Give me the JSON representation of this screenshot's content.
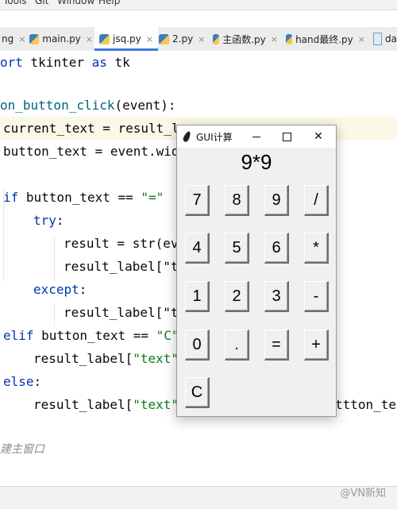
{
  "ide": {
    "menu": [
      "Tools",
      "Git",
      "Window",
      "Help"
    ],
    "tabs": [
      {
        "label": "ng",
        "active": false
      },
      {
        "label": "main.py",
        "active": false
      },
      {
        "label": "jsq.py",
        "active": true
      },
      {
        "label": "2.py",
        "active": false
      },
      {
        "label": "主函数.py",
        "active": false
      },
      {
        "label": "hand最终.py",
        "active": false
      },
      {
        "label": "da",
        "active": false
      }
    ],
    "tab_close_glyph": "×",
    "code": {
      "l1_kw": "ort",
      "l1_rest": " tkinter ",
      "l1_as": "as",
      "l1_tk": " tk",
      "l3_fn": "on_button_click",
      "l3_rest": "(event):",
      "l4": "current_text = result_l",
      "l5": "button_text = event.wid",
      "l7_kw": "if",
      "l7_rest": " button_text == ",
      "l7_str": "\"=\"",
      "l8_kw": "try",
      "l9_a": "result = str(ev",
      "l10_a": "result_label[\"t",
      "l11_kw": "except",
      "l12_a": "result_label[\"t",
      "l13_kw": "elif",
      "l13_rest": " button_text == ",
      "l13_str": "\"C\"",
      "l14_a": "result_label[",
      "l14_str": "\"text\"",
      "l15_kw": "else",
      "l16_a": "result_label[",
      "l16_str": "\"text\"",
      "l16_tail": "ttton_tex",
      "l18_cmt": "建主窗口"
    },
    "watermark": "@VN新知"
  },
  "calculator": {
    "title": "GUI计算",
    "display": "9*9",
    "buttons": [
      [
        "7",
        "8",
        "9",
        "/"
      ],
      [
        "4",
        "5",
        "6",
        "*"
      ],
      [
        "1",
        "2",
        "3",
        "-"
      ],
      [
        "0",
        ".",
        "=",
        "+"
      ],
      [
        "C"
      ]
    ],
    "close_glyph": "✕"
  }
}
